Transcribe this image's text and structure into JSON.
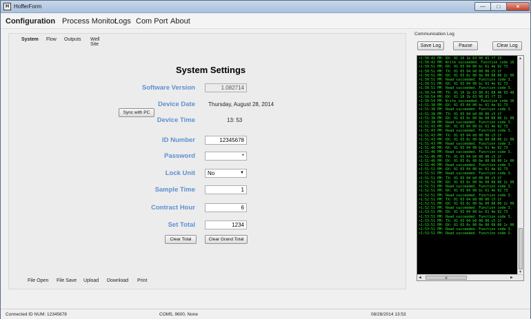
{
  "window": {
    "title": "HofferForm",
    "icon": "app-logo-icon"
  },
  "menu": [
    "Configuration",
    "Process Monitor",
    "Logs",
    "Com Port",
    "About"
  ],
  "subtabs": [
    "System",
    "Flow",
    "Outputs",
    "Well Site"
  ],
  "settings": {
    "heading": "System Settings",
    "software_version_label": "Software Version",
    "software_version_value": "1.082714",
    "device_date_label": "Device Date",
    "device_date_value": "Thursday, August 28, 2014",
    "sync_button": "Sync with PC",
    "device_time_label": "Device Time",
    "device_time_value": "13: 53",
    "id_number_label": "ID Number",
    "id_number_value": "12345678",
    "password_label": "Password",
    "password_value": "*",
    "lock_unit_label": "Lock Unit",
    "lock_unit_value": "No",
    "sample_time_label": "Sample Time",
    "sample_time_value": "1",
    "contract_hour_label": "Contract Hour",
    "contract_hour_value": "6",
    "set_total_label": "Set Total",
    "set_total_value": "1234",
    "clear_total_button": "Clear Total",
    "clear_grand_total_button": "Clear Grand Total"
  },
  "bottom_actions": [
    "File Open",
    "File Save",
    "Upload",
    "Download",
    "Print"
  ],
  "comm_log": {
    "title": "Communication Log",
    "save_button": "Save Log",
    "pause_button": "Pause",
    "clear_button": "Clear Log",
    "lines": [
      ">1:50:42 PM: RX: 01 10 1b 63 00 01 f7 33",
      ">1:50:42 PM: Write succeeded. Function code 16",
      ">1:50:51 PM: RX: 01 03 04 00 bc 61 4e 92 73",
      ">1:50:51 PM: TX: 01 03 04 b0 00 06 c5 1f",
      ">1:50:51 PM: RX: 01 03 0c 00 0e 00 08 00 1c 00",
      ">1:50:51 PM: Read succeeded. Function code 3.",
      ">1:50:51 PM: RX: 01 03 04 00 bc 61 4e 92 73",
      ">1:50:51 PM: Read succeeded. Function code 3.",
      ">1:50:54 PM: TX: 01 10 1b 63 00 01 08 40 93 48",
      ">1:50:54 PM: RX: 01 10 1b 63 00 01 f7 33",
      ">1:50:54 PM: Write succeeded. Function code 16",
      ">1:51:38 PM: RX: 01 03 04 00 bc 61 4e 92 73",
      ">1:51:38 PM: Read succeeded. Function code 3.",
      ">1:51:38 PM: TX: 01 03 04 b0 00 06 c5 1f",
      ">1:51:38 PM: RX: 01 03 0c 00 0e 00 08 00 1c 00",
      ">1:51:38 PM: Read succeeded. Function code 3.",
      ">1:51:43 PM: RX: 01 03 04 00 bc 61 4e 92 73",
      ">1:51:43 PM: Read succeeded. Function code 3.",
      ">1:51:43 PM: TX: 01 03 04 b0 00 06 c5 1f",
      ">1:51:43 PM: RX: 01 03 0c 00 0e 00 08 00 1c 00",
      ">1:51:43 PM: Read succeeded. Function code 3.",
      ">1:51:46 PM: RX: 01 03 04 00 bc 61 4e 92 73",
      ">1:51:46 PM: Read succeeded. Function code 3.",
      ">1:51:46 PM: TX: 01 03 04 b0 00 06 c5 1f",
      ">1:51:46 PM: RX: 01 03 0c 00 0e 00 08 00 1c 00",
      ">1:51:46 PM: Read succeeded. Function code 3.",
      ">1:51:51 PM: RX: 01 03 04 00 bc 61 4e 92 73",
      ">1:51:51 PM: Read succeeded. Function code 3.",
      ">1:51:51 PM: TX: 01 03 04 b0 00 06 c5 1f",
      ">1:51:51 PM: RX: 01 03 0c 00 0e 00 08 00 1c 00",
      ">1:51:51 PM: Read succeeded. Function code 3.",
      ">1:52:51 PM: RX: 01 03 04 00 bc 61 4e 92 73",
      ">1:52:51 PM: Read succeeded. Function code 3.",
      ">1:52:51 PM: TX: 01 03 04 b0 00 06 c5 1f",
      ">1:52:51 PM: RX: 01 03 0c 00 0e 00 08 00 1c 00",
      ">1:52:51 PM: Read succeeded. Function code 3.",
      ">1:53:51 PM: RX: 01 03 04 00 bc 61 4e 92 73",
      ">1:53:51 PM: Read succeeded. Function code 3.",
      ">1:53:51 PM: TX: 01 03 04 b0 00 06 c5 1f",
      ">1:53:51 PM: RX: 01 03 0c 00 0e 00 08 00 1c 00",
      ">1:53:51 PM: Read succeeded. Function code 3.",
      ">1:53:51 PM: Read succeeded. Function code 3."
    ]
  },
  "status": {
    "connection": "Connected ID NUM: 12345678",
    "port": "COM5, 9600, None",
    "datetime": "08/28/2014 13:53"
  }
}
